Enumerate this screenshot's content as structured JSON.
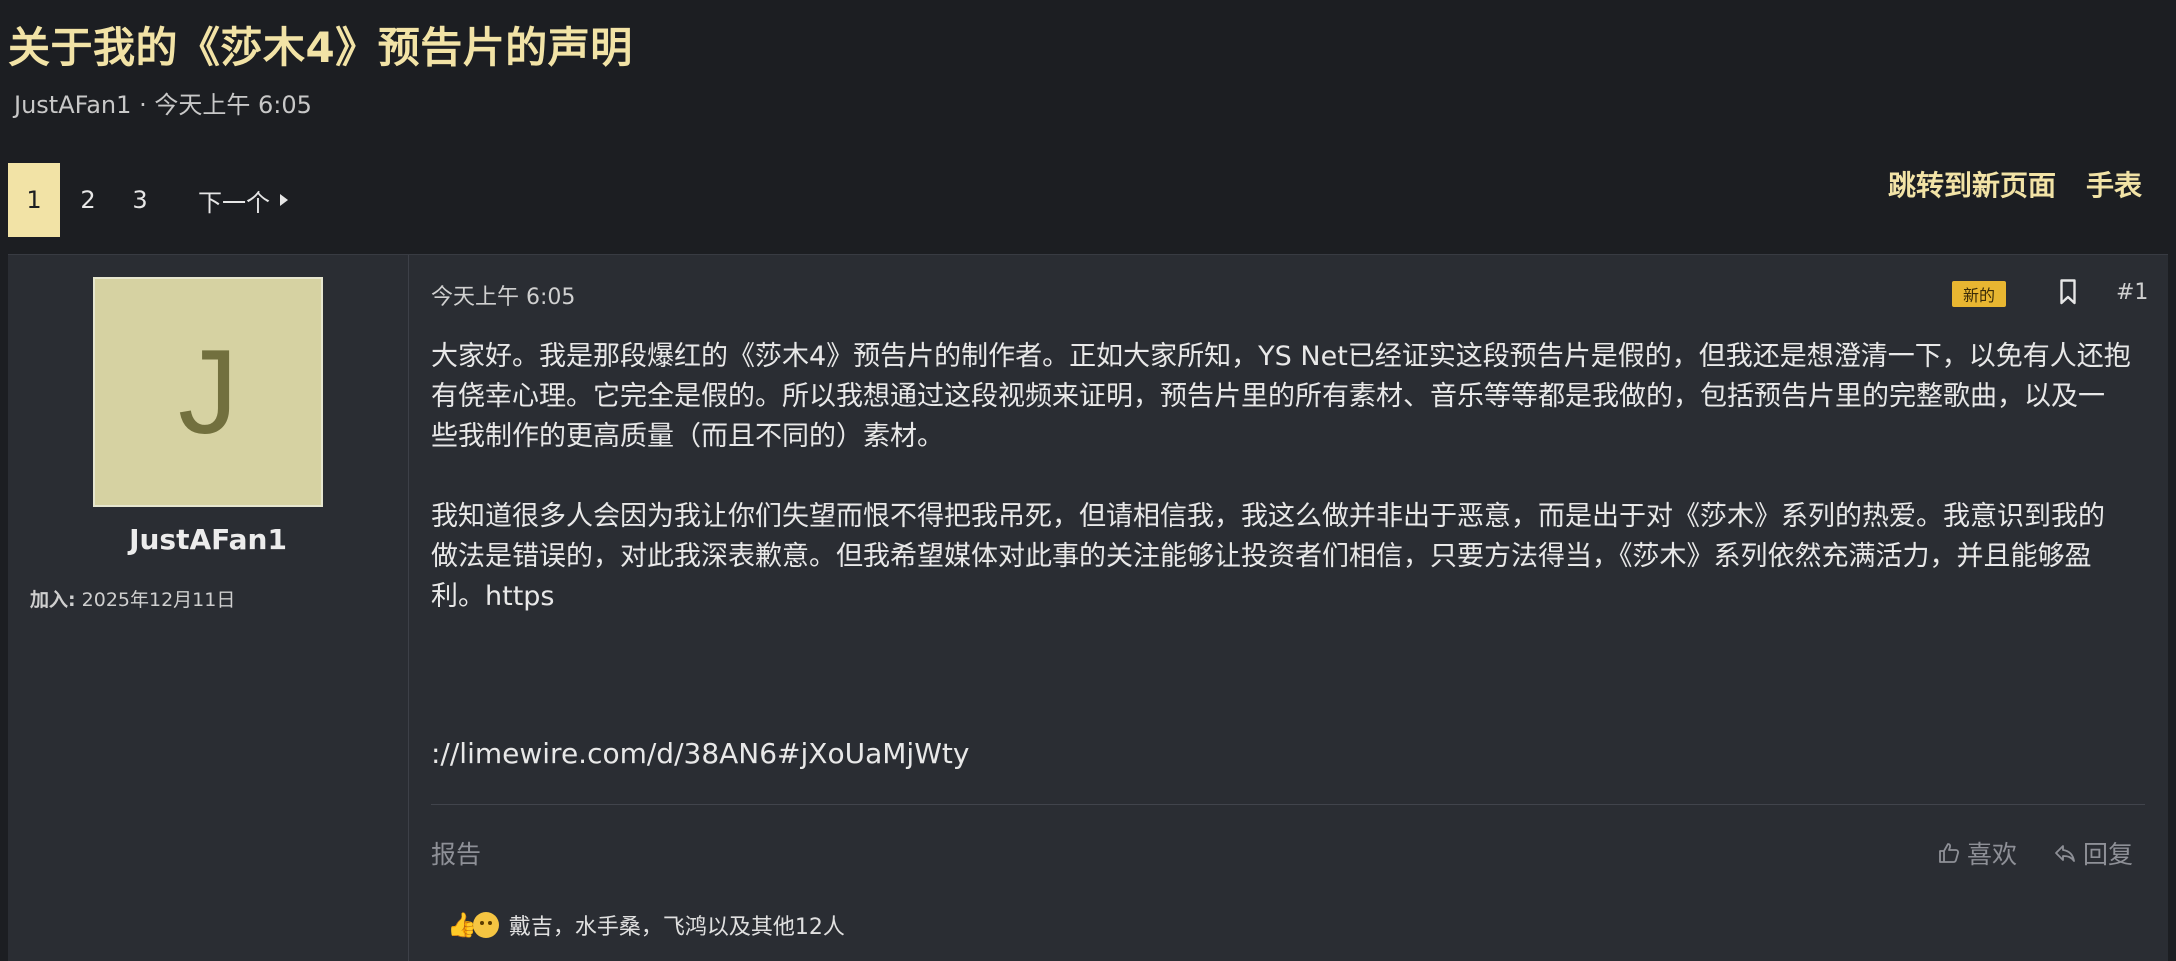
{
  "thread": {
    "title": "关于我的《莎木4》预告片的声明",
    "author": "JustAFan1",
    "separator": "·",
    "posted": "今天上午 6:05"
  },
  "pagination": {
    "pages": [
      "1",
      "2",
      "3"
    ],
    "current": "1",
    "next_label": "下一个"
  },
  "top_actions": {
    "jump_label": "跳转到新页面",
    "watch_label": "手表"
  },
  "post": {
    "user": {
      "avatar_letter": "J",
      "name": "JustAFan1",
      "joined_label": "加入:",
      "joined_date": "2025年12月11日"
    },
    "time": "今天上午 6:05",
    "new_badge": "新的",
    "number": "#1",
    "paragraphs": [
      "大家好。我是那段爆红的《莎木4》预告片的制作者。正如大家所知，YS Net已经证实这段预告片是假的，但我还是想澄清一下，以免有人还抱有侥幸心理。它完全是假的。所以我想通过这段视频来证明，预告片里的所有素材、音乐等等都是我做的，包括预告片里的完整歌曲，以及一些我制作的更高质量（而且不同的）素材。",
      "我知道很多人会因为我让你们失望而恨不得把我吊死，但请相信我，我这么做并非出于恶意，而是出于对《莎木》系列的热爱。我意识到我的做法是错误的，对此我深表歉意。但我希望媒体对此事的关注能够让投资者们相信，只要方法得当，《莎木》系列依然充满活力，并且能够盈利。https"
    ],
    "link": "://limewire.com/d/38AN6#jXoUaMjWty",
    "report_label": "报告",
    "like_label": "喜欢",
    "reply_label": "回复",
    "reactions_text": "戴吉，水手桑，飞鸿以及其他12人"
  },
  "colors": {
    "accent": "#f2e3a6",
    "badge": "#e8b631",
    "background": "#1c1e22",
    "panel": "#2a2d33"
  }
}
